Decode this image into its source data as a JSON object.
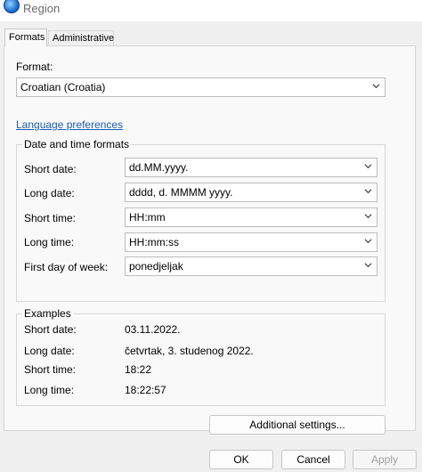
{
  "window": {
    "title": "Region"
  },
  "tabs": [
    {
      "label": "Formats"
    },
    {
      "label": "Administrative"
    }
  ],
  "format": {
    "label": "Format:",
    "value": "Croatian (Croatia)"
  },
  "language_link": "Language preferences",
  "datetime": {
    "title": "Date and time formats",
    "rows": [
      {
        "label": "Short date:",
        "value": "dd.MM.yyyy."
      },
      {
        "label": "Long date:",
        "value": "dddd, d. MMMM yyyy."
      },
      {
        "label": "Short time:",
        "value": "HH:mm"
      },
      {
        "label": "Long time:",
        "value": "HH:mm:ss"
      },
      {
        "label": "First day of week:",
        "value": "ponedjeljak"
      }
    ]
  },
  "examples": {
    "title": "Examples",
    "rows": [
      {
        "label": "Short date:",
        "value": "03.11.2022."
      },
      {
        "label": "Long date:",
        "value": "četvrtak, 3. studenog 2022."
      },
      {
        "label": "Short time:",
        "value": "18:22"
      },
      {
        "label": "Long time:",
        "value": "18:22:57"
      }
    ]
  },
  "buttons": {
    "additional": "Additional settings...",
    "ok": "OK",
    "cancel": "Cancel",
    "apply": "Apply"
  }
}
